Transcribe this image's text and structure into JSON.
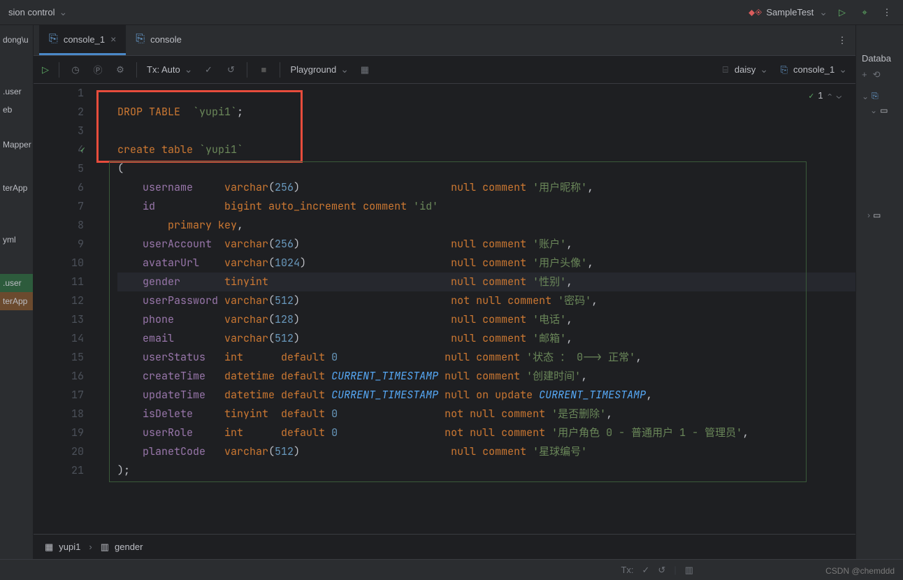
{
  "titlebar": {
    "left_label": "sion control",
    "run_config": "SampleTest"
  },
  "left_strip": [
    "dong\\u",
    "",
    "",
    "",
    "",
    ".user",
    "eb",
    "",
    "",
    "Mapper",
    "",
    "",
    "",
    "terApp",
    "",
    "",
    "",
    "",
    "yml",
    "",
    "",
    "",
    ".user",
    "terApp"
  ],
  "tabs": [
    {
      "label": "console_1",
      "active": true,
      "closable": true
    },
    {
      "label": "console",
      "active": false,
      "closable": false
    }
  ],
  "toolbar": {
    "tx_label": "Tx: Auto",
    "playground_label": "Playground",
    "datasource": "daisy",
    "console_sel": "console_1"
  },
  "inspection_count": "1",
  "code_lines": [
    {
      "n": 1,
      "tokens": []
    },
    {
      "n": 2,
      "tokens": [
        {
          "t": "DROP TABLE",
          "c": "c-kw"
        },
        {
          "t": "  ",
          "c": ""
        },
        {
          "t": "`yupi1`",
          "c": "c-str"
        },
        {
          "t": ";",
          "c": ""
        }
      ]
    },
    {
      "n": 3,
      "tokens": []
    },
    {
      "n": 4,
      "check": true,
      "tokens": [
        {
          "t": "create table",
          "c": "c-kw"
        },
        {
          "t": " ",
          "c": ""
        },
        {
          "t": "`yupi1`",
          "c": "c-str"
        }
      ]
    },
    {
      "n": 5,
      "tokens": [
        {
          "t": "(",
          "c": ""
        }
      ]
    },
    {
      "n": 6,
      "tokens": [
        {
          "t": "    username     ",
          "c": "c-id"
        },
        {
          "t": "varchar",
          "c": "c-kw"
        },
        {
          "t": "(",
          "c": ""
        },
        {
          "t": "256",
          "c": "c-num"
        },
        {
          "t": ")                        ",
          "c": ""
        },
        {
          "t": "null",
          "c": "c-kw"
        },
        {
          "t": " ",
          "c": ""
        },
        {
          "t": "comment",
          "c": "c-kw"
        },
        {
          "t": " ",
          "c": ""
        },
        {
          "t": "'用户昵称'",
          "c": "c-str"
        },
        {
          "t": ",",
          "c": ""
        }
      ]
    },
    {
      "n": 7,
      "tokens": [
        {
          "t": "    id           ",
          "c": "c-id"
        },
        {
          "t": "bigint",
          "c": "c-kw"
        },
        {
          "t": " ",
          "c": ""
        },
        {
          "t": "auto_increment",
          "c": "c-kw"
        },
        {
          "t": " ",
          "c": ""
        },
        {
          "t": "comment",
          "c": "c-kw"
        },
        {
          "t": " ",
          "c": ""
        },
        {
          "t": "'id'",
          "c": "c-str"
        }
      ]
    },
    {
      "n": 8,
      "tokens": [
        {
          "t": "        ",
          "c": ""
        },
        {
          "t": "primary key",
          "c": "c-kw"
        },
        {
          "t": ",",
          "c": ""
        }
      ]
    },
    {
      "n": 9,
      "tokens": [
        {
          "t": "    userAccount  ",
          "c": "c-id"
        },
        {
          "t": "varchar",
          "c": "c-kw"
        },
        {
          "t": "(",
          "c": ""
        },
        {
          "t": "256",
          "c": "c-num"
        },
        {
          "t": ")                        ",
          "c": ""
        },
        {
          "t": "null",
          "c": "c-kw"
        },
        {
          "t": " ",
          "c": ""
        },
        {
          "t": "comment",
          "c": "c-kw"
        },
        {
          "t": " ",
          "c": ""
        },
        {
          "t": "'账户'",
          "c": "c-str"
        },
        {
          "t": ",",
          "c": ""
        }
      ]
    },
    {
      "n": 10,
      "tokens": [
        {
          "t": "    avatarUrl    ",
          "c": "c-id"
        },
        {
          "t": "varchar",
          "c": "c-kw"
        },
        {
          "t": "(",
          "c": ""
        },
        {
          "t": "1024",
          "c": "c-num"
        },
        {
          "t": ")                       ",
          "c": ""
        },
        {
          "t": "null",
          "c": "c-kw"
        },
        {
          "t": " ",
          "c": ""
        },
        {
          "t": "comment",
          "c": "c-kw"
        },
        {
          "t": " ",
          "c": ""
        },
        {
          "t": "'用户头像'",
          "c": "c-str"
        },
        {
          "t": ",",
          "c": ""
        }
      ]
    },
    {
      "n": 11,
      "current": true,
      "tokens": [
        {
          "t": "    gender       ",
          "c": "c-id"
        },
        {
          "t": "tinyint",
          "c": "c-kw"
        },
        {
          "t": "                             ",
          "c": ""
        },
        {
          "t": "null",
          "c": "c-kw"
        },
        {
          "t": " ",
          "c": ""
        },
        {
          "t": "comment",
          "c": "c-kw"
        },
        {
          "t": " ",
          "c": ""
        },
        {
          "t": "'性别'",
          "c": "c-str"
        },
        {
          "t": ",",
          "c": ""
        }
      ]
    },
    {
      "n": 12,
      "tokens": [
        {
          "t": "    userPassword ",
          "c": "c-id"
        },
        {
          "t": "varchar",
          "c": "c-kw"
        },
        {
          "t": "(",
          "c": ""
        },
        {
          "t": "512",
          "c": "c-num"
        },
        {
          "t": ")                        ",
          "c": ""
        },
        {
          "t": "not null",
          "c": "c-kw"
        },
        {
          "t": " ",
          "c": ""
        },
        {
          "t": "comment",
          "c": "c-kw"
        },
        {
          "t": " ",
          "c": ""
        },
        {
          "t": "'密码'",
          "c": "c-str"
        },
        {
          "t": ",",
          "c": ""
        }
      ]
    },
    {
      "n": 13,
      "tokens": [
        {
          "t": "    phone        ",
          "c": "c-id"
        },
        {
          "t": "varchar",
          "c": "c-kw"
        },
        {
          "t": "(",
          "c": ""
        },
        {
          "t": "128",
          "c": "c-num"
        },
        {
          "t": ")                        ",
          "c": ""
        },
        {
          "t": "null",
          "c": "c-kw"
        },
        {
          "t": " ",
          "c": ""
        },
        {
          "t": "comment",
          "c": "c-kw"
        },
        {
          "t": " ",
          "c": ""
        },
        {
          "t": "'电话'",
          "c": "c-str"
        },
        {
          "t": ",",
          "c": ""
        }
      ]
    },
    {
      "n": 14,
      "tokens": [
        {
          "t": "    email        ",
          "c": "c-id"
        },
        {
          "t": "varchar",
          "c": "c-kw"
        },
        {
          "t": "(",
          "c": ""
        },
        {
          "t": "512",
          "c": "c-num"
        },
        {
          "t": ")                        ",
          "c": ""
        },
        {
          "t": "null",
          "c": "c-kw"
        },
        {
          "t": " ",
          "c": ""
        },
        {
          "t": "comment",
          "c": "c-kw"
        },
        {
          "t": " ",
          "c": ""
        },
        {
          "t": "'邮箱'",
          "c": "c-str"
        },
        {
          "t": ",",
          "c": ""
        }
      ]
    },
    {
      "n": 15,
      "tokens": [
        {
          "t": "    userStatus   ",
          "c": "c-id"
        },
        {
          "t": "int",
          "c": "c-kw"
        },
        {
          "t": "      ",
          "c": ""
        },
        {
          "t": "default",
          "c": "c-kw"
        },
        {
          "t": " ",
          "c": ""
        },
        {
          "t": "0",
          "c": "c-num"
        },
        {
          "t": "                 ",
          "c": ""
        },
        {
          "t": "null",
          "c": "c-kw"
        },
        {
          "t": " ",
          "c": ""
        },
        {
          "t": "comment",
          "c": "c-kw"
        },
        {
          "t": " ",
          "c": ""
        },
        {
          "t": "'状态 ： 0--> 正常'",
          "c": "c-str"
        },
        {
          "t": ",",
          "c": ""
        }
      ]
    },
    {
      "n": 16,
      "tokens": [
        {
          "t": "    createTime   ",
          "c": "c-id"
        },
        {
          "t": "datetime",
          "c": "c-kw"
        },
        {
          "t": " ",
          "c": ""
        },
        {
          "t": "default",
          "c": "c-kw"
        },
        {
          "t": " ",
          "c": ""
        },
        {
          "t": "CURRENT_TIMESTAMP",
          "c": "c-const"
        },
        {
          "t": " ",
          "c": ""
        },
        {
          "t": "null",
          "c": "c-kw"
        },
        {
          "t": " ",
          "c": ""
        },
        {
          "t": "comment",
          "c": "c-kw"
        },
        {
          "t": " ",
          "c": ""
        },
        {
          "t": "'创建时间'",
          "c": "c-str"
        },
        {
          "t": ",",
          "c": ""
        }
      ]
    },
    {
      "n": 17,
      "tokens": [
        {
          "t": "    updateTime   ",
          "c": "c-id"
        },
        {
          "t": "datetime",
          "c": "c-kw"
        },
        {
          "t": " ",
          "c": ""
        },
        {
          "t": "default",
          "c": "c-kw"
        },
        {
          "t": " ",
          "c": ""
        },
        {
          "t": "CURRENT_TIMESTAMP",
          "c": "c-const"
        },
        {
          "t": " ",
          "c": ""
        },
        {
          "t": "null",
          "c": "c-kw"
        },
        {
          "t": " ",
          "c": ""
        },
        {
          "t": "on update",
          "c": "c-kw"
        },
        {
          "t": " ",
          "c": ""
        },
        {
          "t": "CURRENT_TIMESTAMP",
          "c": "c-const"
        },
        {
          "t": ",",
          "c": ""
        }
      ]
    },
    {
      "n": 18,
      "tokens": [
        {
          "t": "    isDelete     ",
          "c": "c-id"
        },
        {
          "t": "tinyint",
          "c": "c-kw"
        },
        {
          "t": "  ",
          "c": ""
        },
        {
          "t": "default",
          "c": "c-kw"
        },
        {
          "t": " ",
          "c": ""
        },
        {
          "t": "0",
          "c": "c-num"
        },
        {
          "t": "                 ",
          "c": ""
        },
        {
          "t": "not null",
          "c": "c-kw"
        },
        {
          "t": " ",
          "c": ""
        },
        {
          "t": "comment",
          "c": "c-kw"
        },
        {
          "t": " ",
          "c": ""
        },
        {
          "t": "'是否删除'",
          "c": "c-str"
        },
        {
          "t": ",",
          "c": ""
        }
      ]
    },
    {
      "n": 19,
      "tokens": [
        {
          "t": "    userRole     ",
          "c": "c-id"
        },
        {
          "t": "int",
          "c": "c-kw"
        },
        {
          "t": "      ",
          "c": ""
        },
        {
          "t": "default",
          "c": "c-kw"
        },
        {
          "t": " ",
          "c": ""
        },
        {
          "t": "0",
          "c": "c-num"
        },
        {
          "t": "                 ",
          "c": ""
        },
        {
          "t": "not null",
          "c": "c-kw"
        },
        {
          "t": " ",
          "c": ""
        },
        {
          "t": "comment",
          "c": "c-kw"
        },
        {
          "t": " ",
          "c": ""
        },
        {
          "t": "'用户角色 0 - 普通用户 1 - 管理员'",
          "c": "c-str"
        },
        {
          "t": ",",
          "c": ""
        }
      ]
    },
    {
      "n": 20,
      "tokens": [
        {
          "t": "    planetCode   ",
          "c": "c-id"
        },
        {
          "t": "varchar",
          "c": "c-kw"
        },
        {
          "t": "(",
          "c": ""
        },
        {
          "t": "512",
          "c": "c-num"
        },
        {
          "t": ")                        ",
          "c": ""
        },
        {
          "t": "null",
          "c": "c-kw"
        },
        {
          "t": " ",
          "c": ""
        },
        {
          "t": "comment",
          "c": "c-kw"
        },
        {
          "t": " ",
          "c": ""
        },
        {
          "t": "'星球编号'",
          "c": "c-str"
        }
      ]
    },
    {
      "n": 21,
      "tokens": [
        {
          "t": ");",
          "c": ""
        }
      ]
    }
  ],
  "breadcrumb": {
    "table": "yupi1",
    "column": "gender"
  },
  "right_panel_title": "Databa",
  "bottom_tx": "Tx:",
  "watermark": "CSDN @chemddd"
}
